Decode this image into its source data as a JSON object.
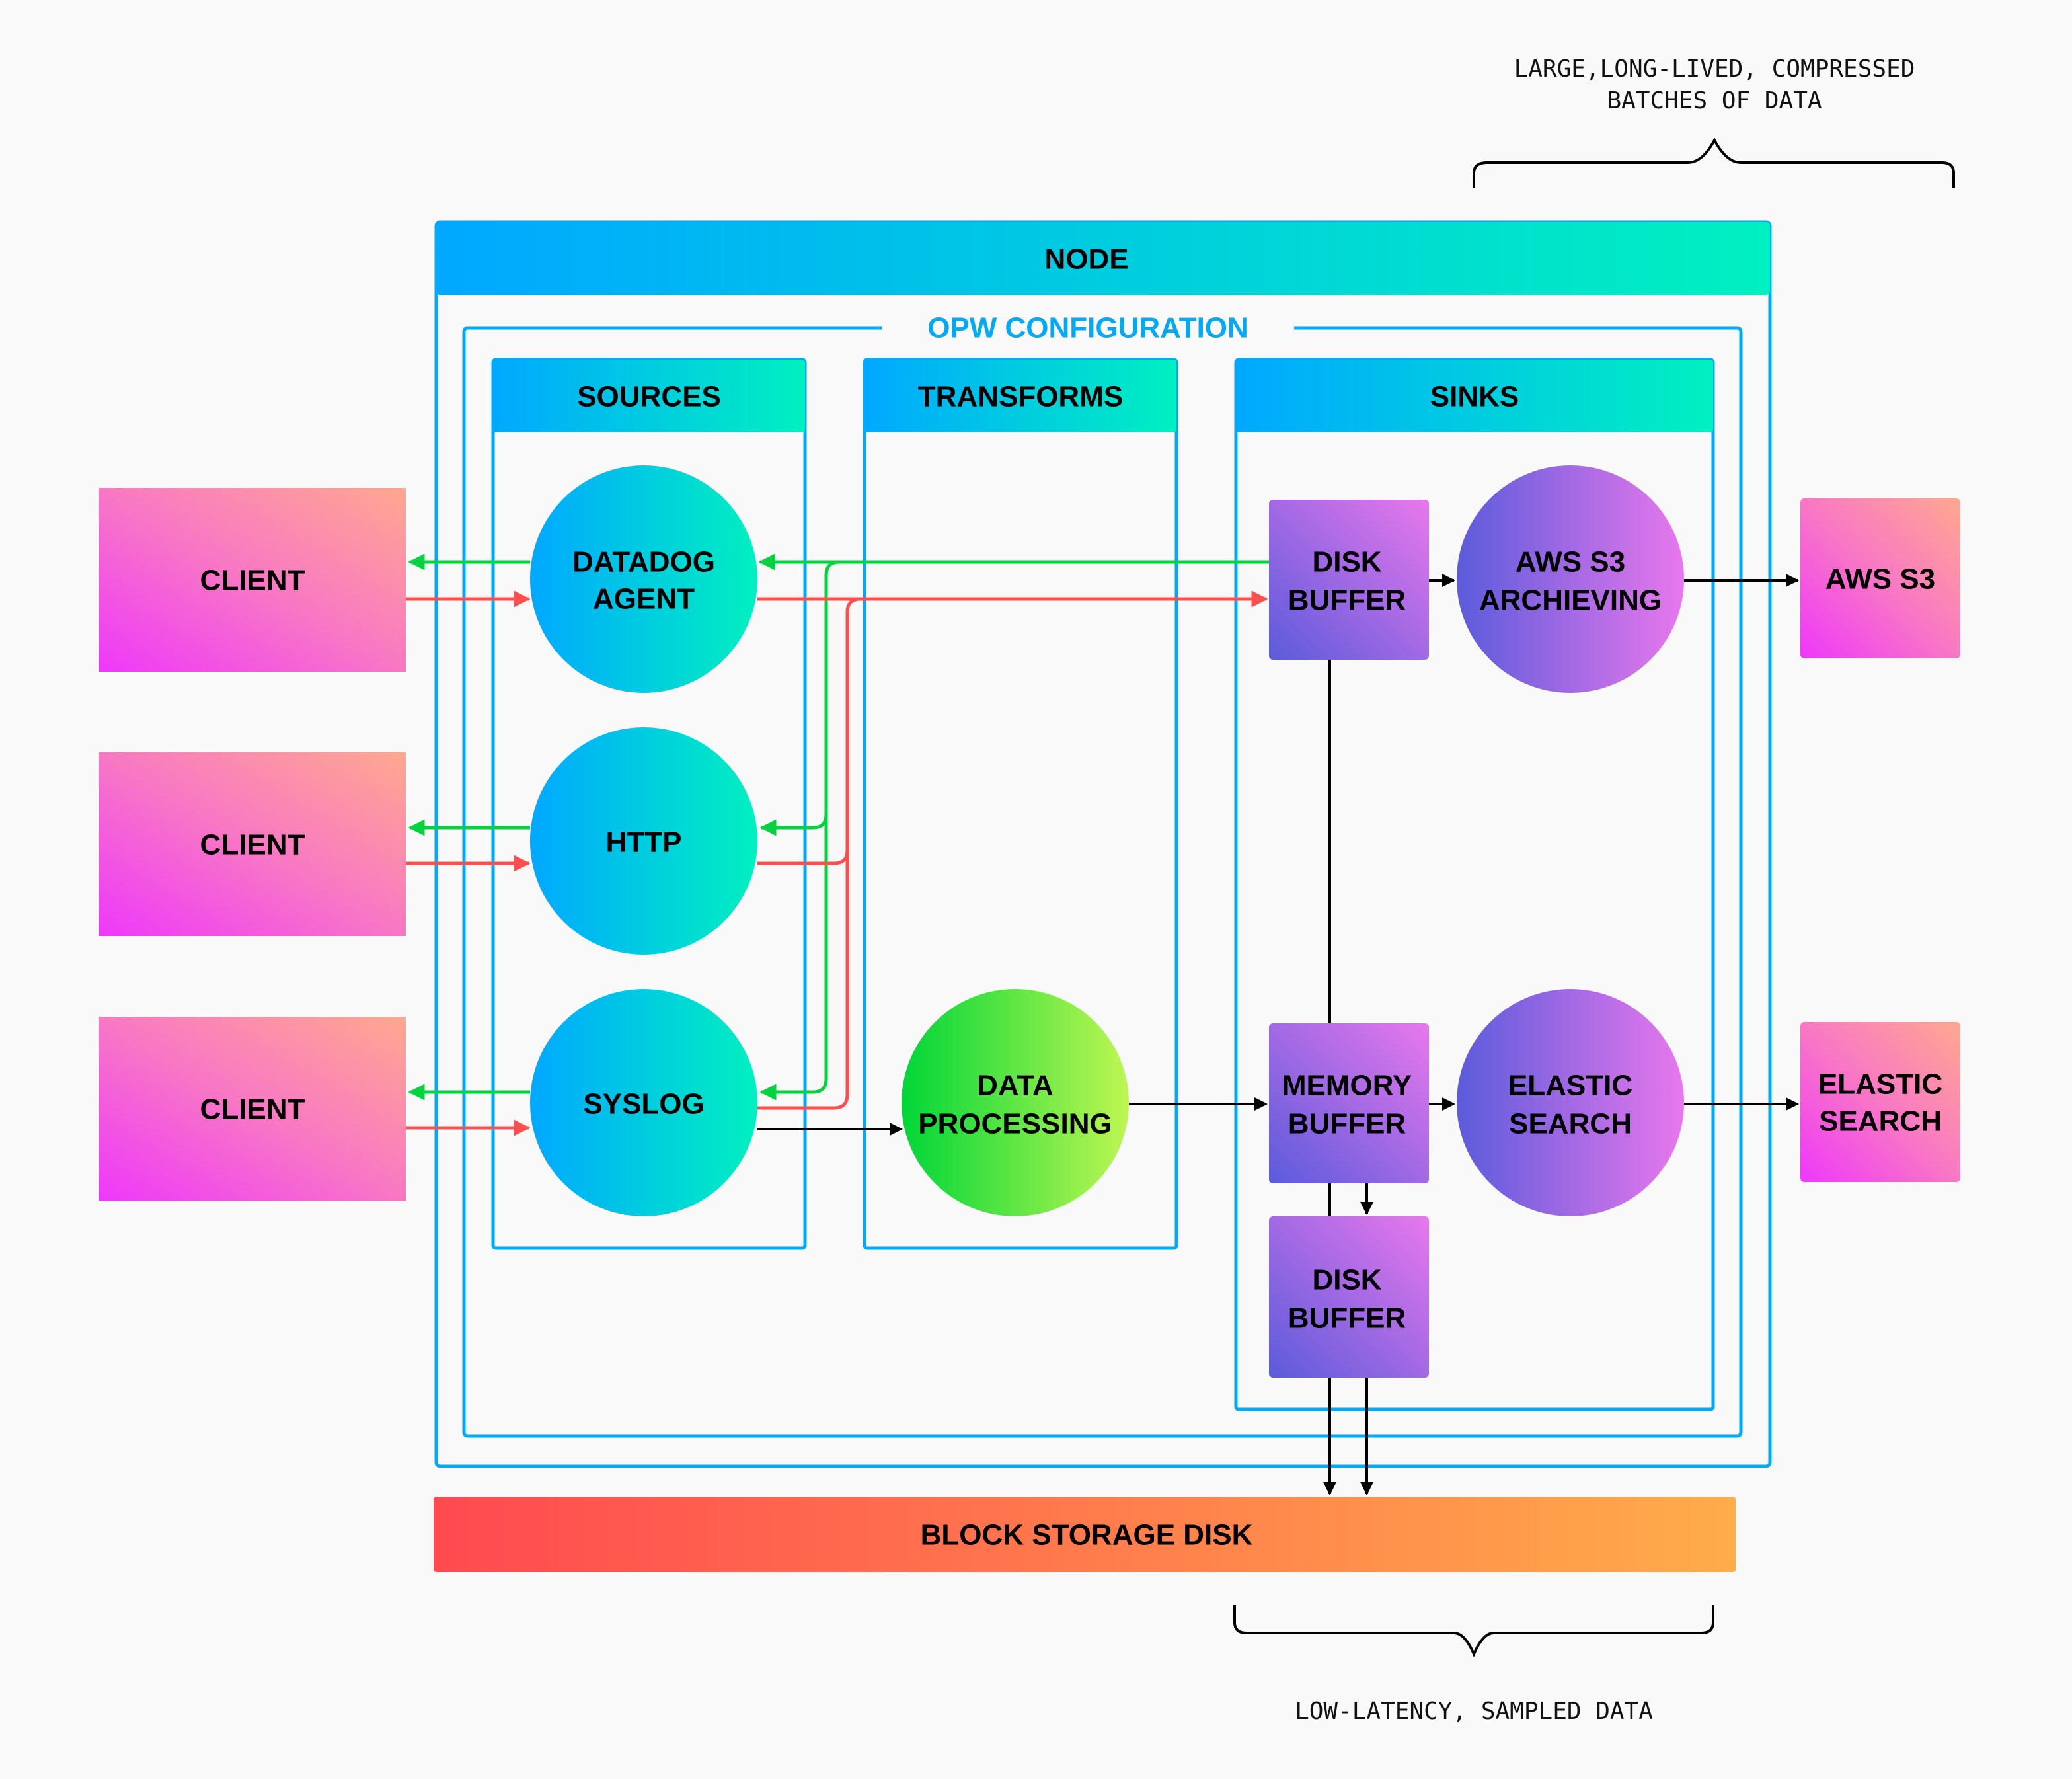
{
  "annotations": {
    "top_note_line1": "LARGE,LONG-LIVED, COMPRESSED",
    "top_note_line2": "BATCHES OF DATA",
    "bottom_note": "LOW-LATENCY, SAMPLED DATA"
  },
  "node": {
    "title": "NODE"
  },
  "opw": {
    "title": "OPW CONFIGURATION"
  },
  "columns": {
    "sources": "SOURCES",
    "transforms": "TRANSFORMS",
    "sinks": "SINKS"
  },
  "clients": [
    {
      "label": "CLIENT"
    },
    {
      "label": "CLIENT"
    },
    {
      "label": "CLIENT"
    }
  ],
  "sources": [
    {
      "line1": "DATADOG",
      "line2": "AGENT"
    },
    {
      "line1": "HTTP",
      "line2": ""
    },
    {
      "line1": "SYSLOG",
      "line2": ""
    }
  ],
  "transform": {
    "line1": "DATA",
    "line2": "PROCESSING"
  },
  "sinks": {
    "disk_buffer_top": {
      "line1": "DISK",
      "line2": "BUFFER"
    },
    "aws_archiving": {
      "line1": "AWS S3",
      "line2": "ARCHIEVING"
    },
    "memory_buffer": {
      "line1": "MEMORY",
      "line2": "BUFFER"
    },
    "elastic": {
      "line1": "ELASTIC",
      "line2": "SEARCH"
    },
    "disk_buffer_bottom": {
      "line1": "DISK",
      "line2": "BUFFER"
    }
  },
  "destinations": {
    "aws_s3": {
      "label": "AWS S3"
    },
    "elastic": {
      "line1": "ELASTIC",
      "line2": "SEARCH"
    }
  },
  "storage": {
    "label": "BLOCK STORAGE DISK"
  },
  "colors": {
    "frame_blue": "#03a9f4",
    "ack_green": "#06d13f",
    "data_red": "#ff4f4f",
    "header_start": "#00a8ff",
    "header_end": "#00f0c0",
    "client_start": "#ee38fa",
    "client_end": "#ffa890",
    "sink_start": "#5b5bdb",
    "sink_end": "#e878ec",
    "transform_start": "#00d638",
    "transform_end": "#bff652",
    "storage_start": "#ff4a50",
    "storage_end": "#ffac4a"
  }
}
